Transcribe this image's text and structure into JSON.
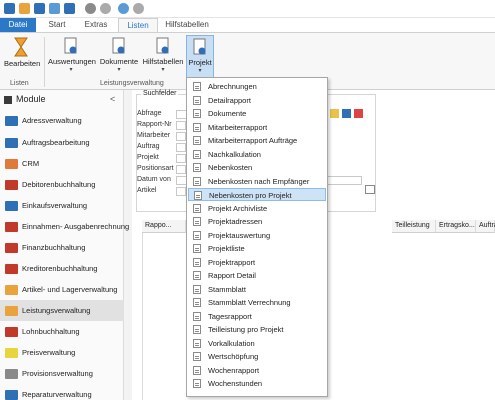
{
  "tabs": {
    "file": "Datei",
    "start": "Start",
    "extras": "Extras",
    "listen": "Listen",
    "hilfstabellen": "Hilfstabellen"
  },
  "ribbon": {
    "bearbeiten": "Bearbeiten",
    "auswertungen": "Auswertungen",
    "dokumente": "Dokumente",
    "hilfstabellen": "Hilfstabellen",
    "projekt": "Projekt",
    "group_listen": "Listen",
    "group_leistung": "Leistungsverwaltung"
  },
  "modules": {
    "title": "Module",
    "collapse": "<",
    "items": [
      {
        "label": "Adressverwaltung",
        "color": "#2f6fb6"
      },
      {
        "label": "Auftragsbearbeitung",
        "color": "#2f6fb6"
      },
      {
        "label": "CRM",
        "color": "#e07a3a"
      },
      {
        "label": "Debitorenbuchhaltung",
        "color": "#c0392b"
      },
      {
        "label": "Einkaufsverwaltung",
        "color": "#2f6fb6"
      },
      {
        "label": "Einnahmen- Ausgabenrechnung",
        "color": "#c0392b"
      },
      {
        "label": "Finanzbuchhaltung",
        "color": "#c0392b"
      },
      {
        "label": "Kreditorenbuchhaltung",
        "color": "#c0392b"
      },
      {
        "label": "Artikel- und Lagerverwaltung",
        "color": "#e8a33c"
      },
      {
        "label": "Leistungsverwaltung",
        "color": "#e8a33c"
      },
      {
        "label": "Lohnbuchhaltung",
        "color": "#c0392b"
      },
      {
        "label": "Preisverwaltung",
        "color": "#e8d43c"
      },
      {
        "label": "Provisionsverwaltung",
        "color": "#8a8a8a"
      },
      {
        "label": "Reparaturverwaltung",
        "color": "#2f6fb6"
      }
    ]
  },
  "form": {
    "group": "Suchfelder",
    "labels": [
      "Abfrage",
      "Rapport-Nr",
      "Mitarbeiter",
      "Auftrag",
      "Projekt",
      "Positionsart",
      "Datum von",
      "Artikel"
    ]
  },
  "grid": {
    "columns": [
      "Rappo...",
      "Teilleistung",
      "Ertragsko...",
      "Auftra"
    ]
  },
  "dropdown": {
    "items": [
      "Abrechnungen",
      "Detailrapport",
      "Dokumente",
      "Mitarbeiterrapport",
      "Mitarbeiterrapport Aufträge",
      "Nachkalkulation",
      "Nebenkosten",
      "Nebenkosten nach Empfänger",
      "Nebenkosten pro Projekt",
      "Projekt Archivliste",
      "Projektadressen",
      "Projektauswertung",
      "Projektliste",
      "Projektrapport",
      "Rapport Detail",
      "Stammblatt",
      "Stammblatt Verrechnung",
      "Tagesrapport",
      "Teilleistung pro Projekt",
      "Vorkalkulation",
      "Wertschöpfung",
      "Wochenrapport",
      "Wochenstunden"
    ],
    "highlighted": "Nebenkosten pro Projekt"
  }
}
